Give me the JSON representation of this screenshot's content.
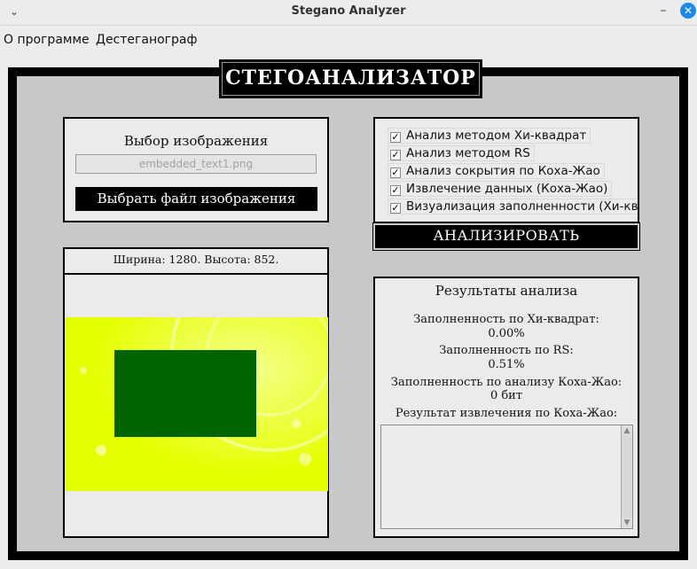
{
  "window": {
    "title": "Stegano Analyzer",
    "menu_glyph": "⌄",
    "minimize_glyph": "–",
    "close_glyph": "✕"
  },
  "menubar": {
    "items": [
      "О программе",
      "Дестеганограф"
    ]
  },
  "header": {
    "title": "СТЕГОАНАЛИЗАТОР"
  },
  "image_select": {
    "title": "Выбор изображения",
    "filename": "embedded_text1.png",
    "button_label": "Выбрать файл изображения"
  },
  "preview": {
    "dimensions": "Ширина: 1280. Высота: 852.",
    "colors": {
      "background": "#e9ff10",
      "hidden_block": "#006400"
    }
  },
  "options": {
    "items": [
      {
        "label": "Анализ методом Хи-квадрат",
        "checked": true
      },
      {
        "label": "Анализ методом RS",
        "checked": true
      },
      {
        "label": "Анализ сокрытия по Коха-Жао",
        "checked": true
      },
      {
        "label": "Извлечение данных (Коха-Жао)",
        "checked": true
      },
      {
        "label": "Визуализация заполненности (Хи-ква",
        "checked": true
      }
    ],
    "check_glyph": "✓"
  },
  "analyze": {
    "button_label": "АНАЛИЗИРОВАТЬ"
  },
  "results": {
    "title": "Результаты анализа",
    "chi_label": "Заполненность по Хи-квадрат:",
    "chi_value": "0.00%",
    "rs_label": "Заполненность по RS:",
    "rs_value": "0.51%",
    "koch_label": "Заполненность по анализу Коха-Жао:",
    "koch_value": "0 бит",
    "extract_label": "Результат извлечения по Коха-Жао:",
    "extract_text": "",
    "scroll_up_glyph": "▲",
    "scroll_down_glyph": "▼"
  }
}
